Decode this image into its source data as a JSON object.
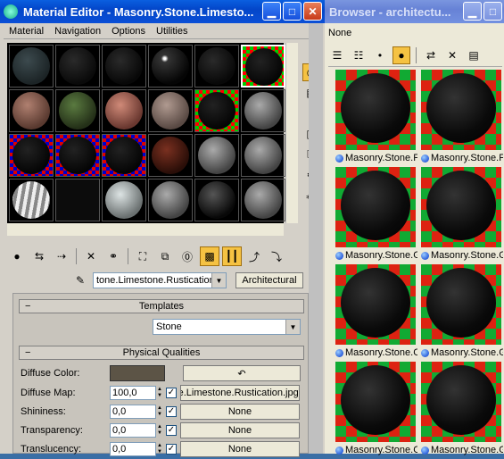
{
  "material_editor": {
    "title": "Material Editor - Masonry.Stone.Limesto...",
    "menu": [
      "Material",
      "Navigation",
      "Options",
      "Utilities"
    ],
    "material_name": "tone.Limestone.Rustication",
    "material_type_button": "Architectural",
    "templates": {
      "header": "Templates",
      "value": "Stone"
    },
    "physical": {
      "header": "Physical Qualities",
      "rows": [
        {
          "label": "Diffuse Color:",
          "value": "",
          "map": "↶"
        },
        {
          "label": "Diffuse Map:",
          "value": "100,0",
          "map": "e.Limestone.Rustication.jpg)"
        },
        {
          "label": "Shininess:",
          "value": "0,0",
          "map": "None"
        },
        {
          "label": "Transparency:",
          "value": "0,0",
          "map": "None"
        },
        {
          "label": "Translucency:",
          "value": "0,0",
          "map": "None"
        }
      ]
    },
    "colors": {
      "diffuse_swatch": "#5c5446"
    }
  },
  "browser": {
    "title": "Browser - architectu...",
    "filter_label": "None",
    "items": [
      "Masonry.Stone.F",
      "Masonry.Stone.F",
      "Masonry.Stone.G",
      "Masonry.Stone.G",
      "Masonry.Stone.C",
      "Masonry.Stone.G",
      "Masonry.Stone.C",
      "Masonry.Stone.G"
    ]
  }
}
